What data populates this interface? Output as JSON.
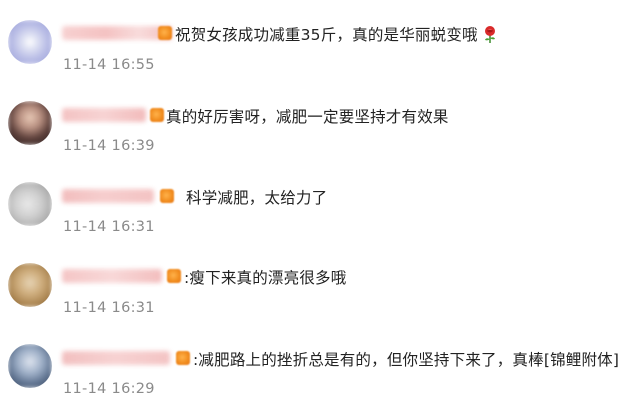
{
  "comments": [
    {
      "text": "祝贺女孩成功减重35斤，真的是华丽蜕变哦",
      "time": "11-14 16:55",
      "trailing_icon": "rose-icon"
    },
    {
      "text": "真的好厉害呀，减肥一定要坚持才有效果",
      "time": "11-14 16:39"
    },
    {
      "text": "科学减肥，太给力了",
      "time": "11-14 16:31"
    },
    {
      "text": ":瘦下来真的漂亮很多哦",
      "time": "11-14 16:31"
    },
    {
      "text": ":减肥路上的挫折总是有的，但你坚持下来了，真棒[锦鲤附体]",
      "time": "11-14 16:29"
    }
  ],
  "colors": {
    "text": "#222222",
    "time": "#8a8a8a",
    "name_blur": "#f3b8b8",
    "badge": "#f08a1c"
  }
}
